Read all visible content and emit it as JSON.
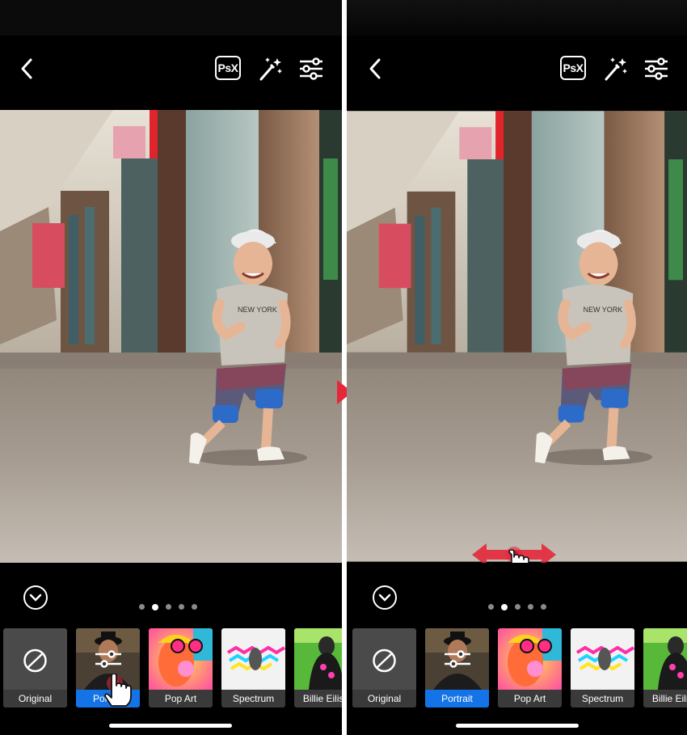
{
  "toolbar": {
    "psx_label": "PsX"
  },
  "filters": [
    {
      "label": "Original",
      "icon": "no-filter-icon"
    },
    {
      "label": "Portrait",
      "icon": "sliders-icon"
    },
    {
      "label": "Pop Art"
    },
    {
      "label": "Spectrum"
    },
    {
      "label": "Billie Eilish"
    }
  ],
  "left_screen": {
    "filter_1_label": "Por",
    "pager": {
      "count": 5,
      "active_index": 1
    }
  },
  "right_screen": {
    "pager": {
      "count": 5,
      "active_index": 1
    }
  },
  "colors": {
    "selected_filter": "#1473e6",
    "annotation_red": "#e4283a"
  }
}
